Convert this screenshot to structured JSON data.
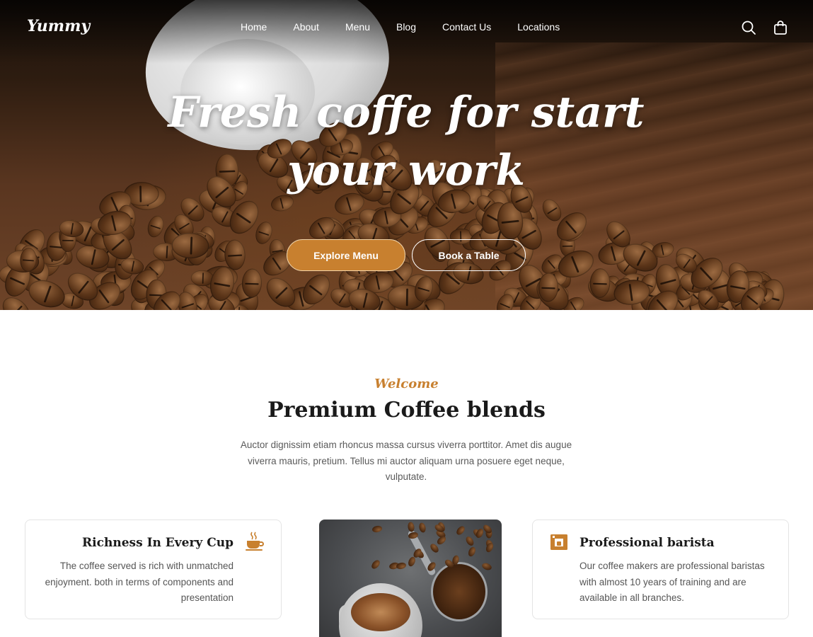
{
  "brand": {
    "logo": "Yummy",
    "accent_color": "#c8802f"
  },
  "nav": {
    "links": [
      {
        "label": "Home"
      },
      {
        "label": "About"
      },
      {
        "label": "Menu"
      },
      {
        "label": "Blog"
      },
      {
        "label": "Contact Us"
      },
      {
        "label": "Locations"
      }
    ],
    "icons": {
      "search": "search-icon",
      "cart": "shopping-bag-icon"
    }
  },
  "hero": {
    "title": "Fresh coffe for start your work",
    "primary_button": "Explore Menu",
    "secondary_button": "Book a Table"
  },
  "intro": {
    "eyebrow": "Welcome",
    "title": "Premium Coffee blends",
    "description": "Auctor dignissim etiam rhoncus massa cursus viverra porttitor. Amet dis augue viverra mauris, pretium. Tellus mi auctor aliquam urna posuere eget neque, vulputate."
  },
  "features": [
    {
      "title": "Richness In Every Cup",
      "text": "The coffee served is rich with unmatched enjoyment. both in terms of components and presentation",
      "icon": "coffee-cup-icon"
    },
    {
      "title": "Professional barista",
      "text": "Our coffee makers are professional baristas with almost 10 years of training and are available in all branches.",
      "icon": "coffee-machine-icon"
    }
  ]
}
